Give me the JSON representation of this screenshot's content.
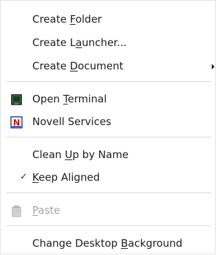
{
  "menu": {
    "create_folder": {
      "pre": "Create ",
      "mn": "F",
      "post": "older"
    },
    "create_launcher": {
      "pre": "Create L",
      "mn": "a",
      "post": "uncher..."
    },
    "create_document": {
      "pre": "Create ",
      "mn": "D",
      "post": "ocument"
    },
    "open_terminal": {
      "pre": "Open ",
      "mn": "T",
      "post": "erminal"
    },
    "novell_services": {
      "pre": "Novell Services",
      "mn": "",
      "post": ""
    },
    "clean_up": {
      "pre": "Clean ",
      "mn": "U",
      "post": "p by Name"
    },
    "keep_aligned": {
      "pre": "",
      "mn": "K",
      "post": "eep Aligned",
      "check": "✓"
    },
    "paste": {
      "pre": "",
      "mn": "P",
      "post": "aste"
    },
    "change_background": {
      "pre": "Change Desktop ",
      "mn": "B",
      "post": "ackground"
    }
  },
  "icons": {
    "terminal": "terminal-icon",
    "novell": "novell-n-icon",
    "paste": "clipboard-icon"
  },
  "colors": {
    "novell_red": "#d01010",
    "terminal_green": "#2f7a3a",
    "disabled_text": "#a3a3a3"
  }
}
